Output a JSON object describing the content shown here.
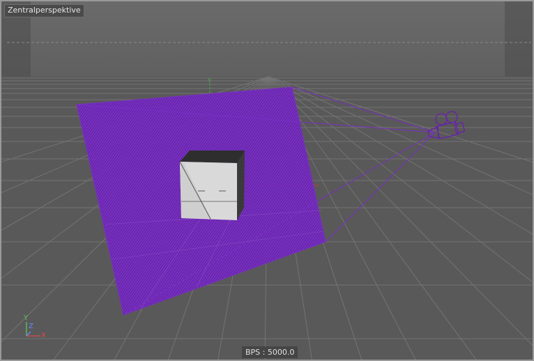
{
  "viewport": {
    "label": "Zentralperspektive",
    "status_readout": "BPS : 5000.0",
    "camera_object_name": "camera-object",
    "target_object_name": "cube-object"
  },
  "axis_gizmo": {
    "y": "Y",
    "z": "Z",
    "x": "X"
  },
  "colors": {
    "background": "#5c5c5c",
    "grid_line": "#767676",
    "camera_frustum": "#7a2fc4",
    "camera_outline": "#6a1fb0",
    "cube_light": "#d8d8d8",
    "cube_dark": "#2c2c2c",
    "axis_x": "#e04a4a",
    "axis_y": "#5ec75e",
    "axis_z": "#6a88ff"
  }
}
